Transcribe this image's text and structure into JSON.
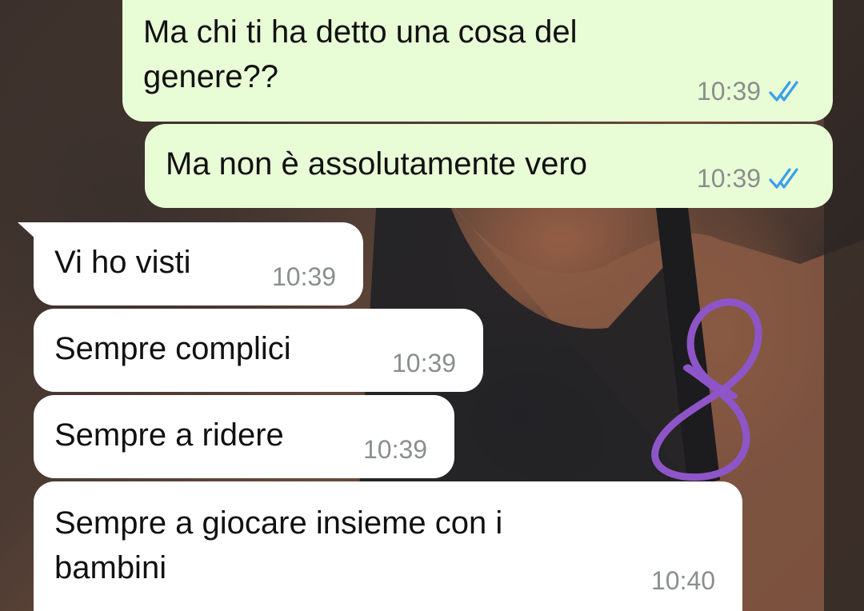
{
  "chat": {
    "messages": [
      {
        "direction": "outgoing",
        "text": "Ma chi ti ha detto una cosa del\ngenere??",
        "time": "10:39",
        "status_icon": "double-check-read-icon"
      },
      {
        "direction": "outgoing",
        "text": "Ma non è assolutamente vero",
        "time": "10:39",
        "status_icon": "double-check-read-icon"
      },
      {
        "direction": "incoming",
        "text": "Vi ho visti",
        "time": "10:39"
      },
      {
        "direction": "incoming",
        "text": "Sempre complici",
        "time": "10:39"
      },
      {
        "direction": "incoming",
        "text": "Sempre a ridere",
        "time": "10:39"
      },
      {
        "direction": "incoming",
        "text": "Sempre a giocare insieme con i\nbambini",
        "time": "10:40"
      }
    ]
  },
  "colors": {
    "outgoing_bubble": "#e8fcd6",
    "incoming_bubble": "#ffffff",
    "read_check": "#3aa0e8",
    "timestamp": "#8a8f8c",
    "annotation_scribble": "#8e55c8"
  },
  "annotation": {
    "icon": "purple-figure-eight-scribble"
  }
}
